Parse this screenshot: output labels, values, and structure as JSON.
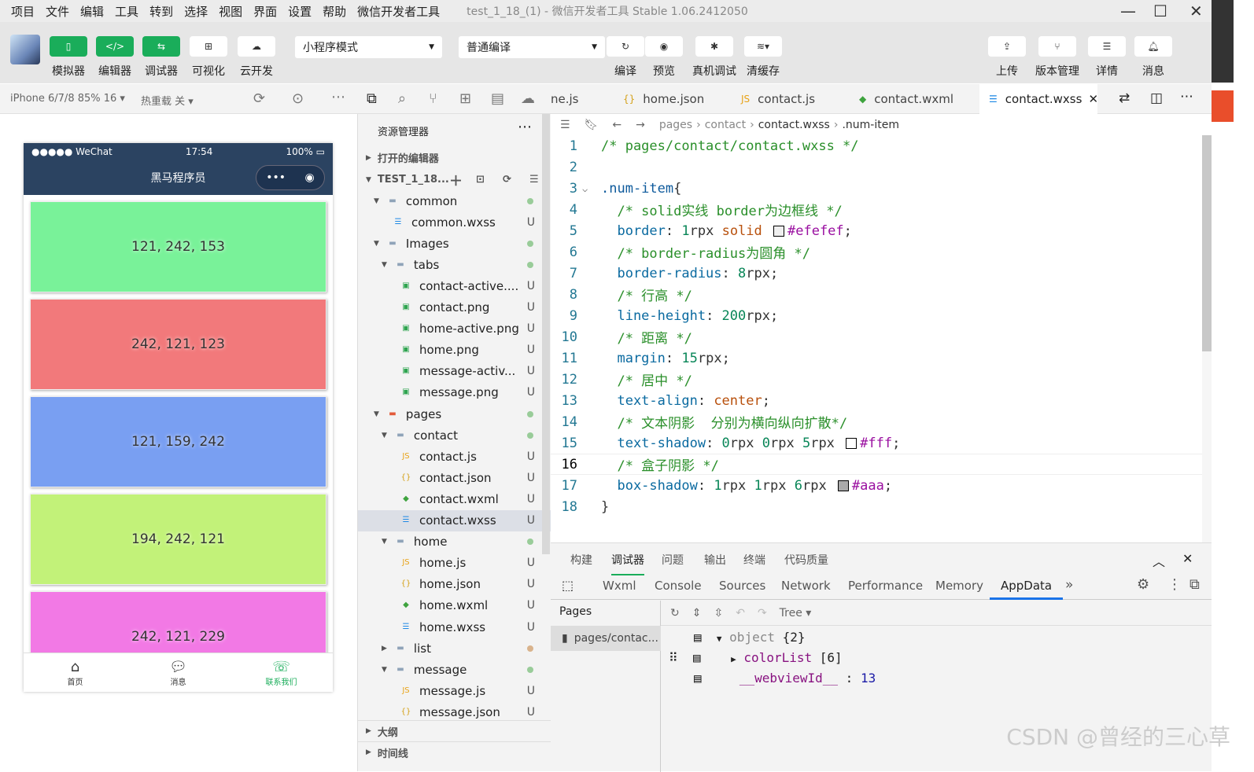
{
  "menu": [
    "项目",
    "文件",
    "编辑",
    "工具",
    "转到",
    "选择",
    "视图",
    "界面",
    "设置",
    "帮助",
    "微信开发者工具"
  ],
  "window_title": "test_1_18_(1) - 微信开发者工具 Stable 1.06.2412050",
  "toolbar": {
    "left": [
      "模拟器",
      "编辑器",
      "调试器",
      "可视化",
      "云开发"
    ],
    "mode": "小程序模式",
    "compile_mode": "普通编译",
    "right": [
      "编译",
      "预览",
      "真机调试",
      "清缓存"
    ],
    "far": [
      "上传",
      "版本管理",
      "详情",
      "消息"
    ]
  },
  "subbar": {
    "device": "iPhone 6/7/8 85% 16 ▾",
    "hot_reload": "热重载 关 ▾"
  },
  "phone": {
    "signal": "●●●●● WeChat",
    "time": "17:54",
    "battery": "100%",
    "title": "黑马程序员",
    "blocks": [
      {
        "label": "121, 242, 153",
        "color": "#79f299"
      },
      {
        "label": "242, 121, 123",
        "color": "#f2797b"
      },
      {
        "label": "121, 159, 242",
        "color": "#799ff2"
      },
      {
        "label": "194, 242, 121",
        "color": "#c2f279"
      },
      {
        "label": "242, 121, 229",
        "color": "#f279e5"
      }
    ],
    "tabs": [
      {
        "label": "首页",
        "icon": "home-icon"
      },
      {
        "label": "消息",
        "icon": "message-icon"
      },
      {
        "label": "联系我们",
        "icon": "contact-icon",
        "active": true
      }
    ]
  },
  "explorer": {
    "title": "资源管理器",
    "open_editors": "打开的编辑器",
    "project": "TEST_1_18...",
    "outline": "大纲",
    "timeline": "时间线",
    "items": [
      {
        "name": "common",
        "depth": 1,
        "type": "folder",
        "open": true
      },
      {
        "name": "common.wxss",
        "depth": 2,
        "type": "wxss",
        "status": "U"
      },
      {
        "name": "Images",
        "depth": 1,
        "type": "folder",
        "open": true
      },
      {
        "name": "tabs",
        "depth": 2,
        "type": "folder",
        "open": true
      },
      {
        "name": "contact-active....",
        "depth": 3,
        "type": "img",
        "status": "U"
      },
      {
        "name": "contact.png",
        "depth": 3,
        "type": "img",
        "status": "U"
      },
      {
        "name": "home-active.png",
        "depth": 3,
        "type": "img",
        "status": "U"
      },
      {
        "name": "home.png",
        "depth": 3,
        "type": "img",
        "status": "U"
      },
      {
        "name": "message-activ...",
        "depth": 3,
        "type": "img",
        "status": "U"
      },
      {
        "name": "message.png",
        "depth": 3,
        "type": "img",
        "status": "U"
      },
      {
        "name": "pages",
        "depth": 1,
        "type": "folder",
        "open": true
      },
      {
        "name": "contact",
        "depth": 2,
        "type": "folder",
        "open": true
      },
      {
        "name": "contact.js",
        "depth": 3,
        "type": "js",
        "status": "U"
      },
      {
        "name": "contact.json",
        "depth": 3,
        "type": "json",
        "status": "U"
      },
      {
        "name": "contact.wxml",
        "depth": 3,
        "type": "wxml",
        "status": "U"
      },
      {
        "name": "contact.wxss",
        "depth": 3,
        "type": "wxss",
        "status": "U",
        "selected": true
      },
      {
        "name": "home",
        "depth": 2,
        "type": "folder",
        "open": true
      },
      {
        "name": "home.js",
        "depth": 3,
        "type": "js",
        "status": "U"
      },
      {
        "name": "home.json",
        "depth": 3,
        "type": "json",
        "status": "U"
      },
      {
        "name": "home.wxml",
        "depth": 3,
        "type": "wxml",
        "status": "U"
      },
      {
        "name": "home.wxss",
        "depth": 3,
        "type": "wxss",
        "status": "U"
      },
      {
        "name": "list",
        "depth": 2,
        "type": "folder",
        "open": false
      },
      {
        "name": "message",
        "depth": 2,
        "type": "folder",
        "open": true
      },
      {
        "name": "message.js",
        "depth": 3,
        "type": "js",
        "status": "U"
      },
      {
        "name": "message.json",
        "depth": 3,
        "type": "json",
        "status": "U"
      }
    ]
  },
  "editor": {
    "tabs": [
      "ne.js",
      "home.json",
      "contact.js",
      "contact.wxml",
      "contact.wxss"
    ],
    "active_tab": 4,
    "breadcrumb": [
      "pages",
      "contact",
      "contact.wxss",
      ".num-item"
    ],
    "lines": [
      [
        [
          "/* pages/contact/contact.wxss */",
          "cm"
        ]
      ],
      [],
      [
        [
          ".num-item",
          "sel"
        ],
        [
          "{",
          "pu"
        ]
      ],
      [
        [
          "  /* solid实线 border为边框线 */",
          "cm"
        ]
      ],
      [
        [
          "  border",
          "pr"
        ],
        [
          ": ",
          "pu"
        ],
        [
          "1",
          "nm"
        ],
        [
          "rpx ",
          "pu"
        ],
        [
          "solid ",
          "kw"
        ],
        [
          "SW:#efefef",
          ""
        ],
        [
          "#efefef",
          "hx"
        ],
        [
          ";",
          "pu"
        ]
      ],
      [
        [
          "  /* border-radius为圆角 */",
          "cm"
        ]
      ],
      [
        [
          "  border-radius",
          "pr"
        ],
        [
          ": ",
          "pu"
        ],
        [
          "8",
          "nm"
        ],
        [
          "rpx;",
          "pu"
        ]
      ],
      [
        [
          "  /* 行高 */",
          "cm"
        ]
      ],
      [
        [
          "  line-height",
          "pr"
        ],
        [
          ": ",
          "pu"
        ],
        [
          "200",
          "nm"
        ],
        [
          "rpx;",
          "pu"
        ]
      ],
      [
        [
          "  /* 距离 */",
          "cm"
        ]
      ],
      [
        [
          "  margin",
          "pr"
        ],
        [
          ": ",
          "pu"
        ],
        [
          "15",
          "nm"
        ],
        [
          "rpx;",
          "pu"
        ]
      ],
      [
        [
          "  /* 居中 */",
          "cm"
        ]
      ],
      [
        [
          "  text-align",
          "pr"
        ],
        [
          ": ",
          "pu"
        ],
        [
          "center",
          "kw"
        ],
        [
          ";",
          "pu"
        ]
      ],
      [
        [
          "  /* 文本阴影  分别为横向纵向扩散*/",
          "cm"
        ]
      ],
      [
        [
          "  text-shadow",
          "pr"
        ],
        [
          ": ",
          "pu"
        ],
        [
          "0",
          "nm"
        ],
        [
          "rpx ",
          "pu"
        ],
        [
          "0",
          "nm"
        ],
        [
          "rpx ",
          "pu"
        ],
        [
          "5",
          "nm"
        ],
        [
          "rpx ",
          "pu"
        ],
        [
          "SW:#ffffff",
          ""
        ],
        [
          "#fff",
          "hx"
        ],
        [
          ";",
          "pu"
        ]
      ],
      [
        [
          "  /* 盒子阴影 */",
          "cm"
        ]
      ],
      [
        [
          "  box-shadow",
          "pr"
        ],
        [
          ": ",
          "pu"
        ],
        [
          "1",
          "nm"
        ],
        [
          "rpx ",
          "pu"
        ],
        [
          "1",
          "nm"
        ],
        [
          "rpx ",
          "pu"
        ],
        [
          "6",
          "nm"
        ],
        [
          "rpx ",
          "pu"
        ],
        [
          "SW:#aaaaaa",
          ""
        ],
        [
          "#aaa",
          "hx"
        ],
        [
          ";",
          "pu"
        ]
      ],
      [
        [
          "}",
          "pu"
        ]
      ]
    ]
  },
  "debugger": {
    "top_tabs": [
      "构建",
      "调试器",
      "问题",
      "输出",
      "终端",
      "代码质量"
    ],
    "active_top": 1,
    "tabs": [
      "Wxml",
      "Console",
      "Sources",
      "Network",
      "Performance",
      "Memory",
      "AppData"
    ],
    "active_tab": 6,
    "more": "»",
    "pages_label": "Pages",
    "page_item": "pages/contac...",
    "view_mode": "Tree",
    "tree": {
      "root": "object",
      "root_count": "{2}",
      "key1": "colorList",
      "key1_count": "[6]",
      "key2": "__webviewId__",
      "key2_value": "13"
    }
  },
  "watermark": "CSDN @曾经的三心草",
  "accent": "#1aad5a"
}
